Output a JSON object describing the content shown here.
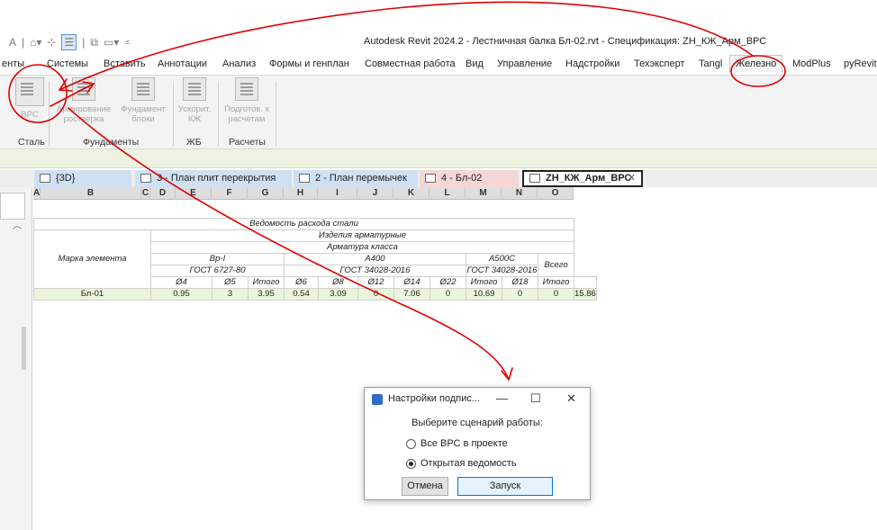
{
  "window": {
    "title": "Autodesk Revit 2024.2 - Лестничная балка Бл-02.rvt - Спецификация: ZH_КЖ_Арм_ВРС"
  },
  "ribbon_tabs": [
    {
      "label": "енты"
    },
    {
      "label": "Системы"
    },
    {
      "label": "Вставить"
    },
    {
      "label": "Аннотации"
    },
    {
      "label": "Анализ"
    },
    {
      "label": "Формы и генплан"
    },
    {
      "label": "Совместная работа"
    },
    {
      "label": "Вид"
    },
    {
      "label": "Управление"
    },
    {
      "label": "Надстройки"
    },
    {
      "label": "Техэксперт"
    },
    {
      "label": "Tangl"
    },
    {
      "label": "Железно"
    },
    {
      "label": "ModPlus"
    },
    {
      "label": "pyRevit"
    }
  ],
  "ribbon": {
    "buttons": [
      {
        "label": "ВРС"
      },
      {
        "label": "Армирование ростверка"
      },
      {
        "label": "Фундамент блоки"
      },
      {
        "label": "Ускорит. КЖ"
      },
      {
        "label": "Подготов. к расчетам"
      }
    ],
    "panels": [
      "Сталь",
      "Фундаменты",
      "ЖБ",
      "Расчеты"
    ]
  },
  "view_tabs": [
    {
      "label": "{3D}"
    },
    {
      "label": "3 - План плит перекрытия"
    },
    {
      "label": "2 - План перемычек"
    },
    {
      "label": "4 - Бл-02"
    },
    {
      "label": "ZH_КЖ_Арм_ВРС",
      "close": "✕"
    }
  ],
  "schedule": {
    "column_letters": [
      "A",
      "B",
      "C",
      "D",
      "E",
      "F",
      "G",
      "H",
      "I",
      "J",
      "K",
      "L",
      "M",
      "N",
      "O"
    ],
    "title": "Ведомость расхода стали",
    "subtitle1": "Изделия арматурные",
    "subtitle2": "Арматура класса",
    "mark_header": "Марка элемента",
    "total_header": "Всего",
    "groups": [
      {
        "class": "Вр-I",
        "gost": "ГОСТ 6727-80"
      },
      {
        "class": "А400",
        "gost": "ГОСТ 34028-2016"
      },
      {
        "class": "А500С",
        "gost": "ГОСТ 34028-2016"
      }
    ],
    "diameters": [
      "Ø4",
      "Ø5",
      "Итого",
      "Ø6",
      "Ø8",
      "Ø12",
      "Ø14",
      "Ø22",
      "Итого",
      "Ø18",
      "Итого"
    ],
    "rows": [
      {
        "mark": "Бл-01",
        "values": [
          "0.95",
          "3",
          "3.95",
          "0.54",
          "3.09",
          "0",
          "7.06",
          "0",
          "10.69",
          "0",
          "0",
          "15.86"
        ]
      }
    ]
  },
  "dialog": {
    "title": "Настройки подпис...",
    "minimize": "—",
    "maximize": "☐",
    "close": "✕",
    "prompt": "Выберите сценарий работы:",
    "options": [
      {
        "label": "Все ВРС в проекте",
        "checked": false
      },
      {
        "label": "Открытая ведомость",
        "checked": true
      }
    ],
    "cancel": "Отмена",
    "run": "Запуск"
  },
  "colors": {
    "annotation": "#e00000",
    "options_bar": "#eef3e1",
    "data_row": "#eaf5dc",
    "view_tab_blue": "#cfe0f3",
    "view_tab_pink": "#f5d6d6"
  }
}
